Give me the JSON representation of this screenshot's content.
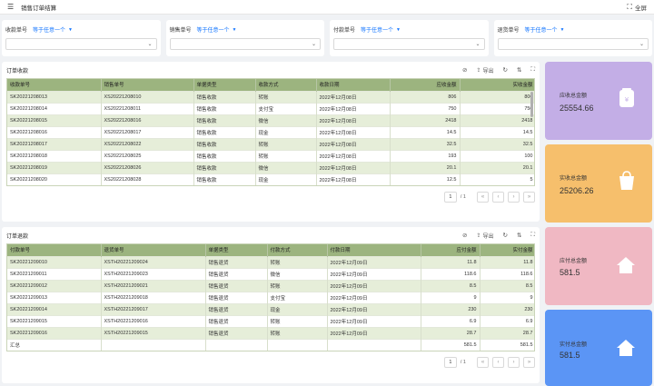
{
  "topbar": {
    "menu_icon": "menu-icon",
    "title": "销售订单结算",
    "fullscreen_label": "全屏"
  },
  "filters": [
    {
      "label": "收款单号",
      "op": "等于任意一个"
    },
    {
      "label": "销售单号",
      "op": "等于任意一个"
    },
    {
      "label": "付款单号",
      "op": "等于任意一个"
    },
    {
      "label": "退货单号",
      "op": "等于任意一个"
    }
  ],
  "receipts": {
    "title": "订单收款",
    "export_label": "导出",
    "columns": [
      "收款单号",
      "销售单号",
      "单据类型",
      "收款方式",
      "收款日期",
      "应收金额",
      "实收金额"
    ],
    "rows": [
      [
        "SK20221208013",
        "XS20221208010",
        "销售收款",
        "转账",
        "2022年12月08日",
        "806",
        "806"
      ],
      [
        "SK20221208014",
        "XS20221208011",
        "销售收款",
        "支付宝",
        "2022年12月08日",
        "750",
        "750"
      ],
      [
        "SK20221208015",
        "XS20221208016",
        "销售收款",
        "微信",
        "2022年12月08日",
        "2418",
        "2418"
      ],
      [
        "SK20221208016",
        "XS20221208017",
        "销售收款",
        "现金",
        "2022年12月08日",
        "14.5",
        "14.5"
      ],
      [
        "SK20221208017",
        "XS20221208022",
        "销售收款",
        "转账",
        "2022年12月08日",
        "32.5",
        "32.5"
      ],
      [
        "SK20221208018",
        "XS20221208025",
        "销售收款",
        "转账",
        "2022年12月08日",
        "193",
        "100"
      ],
      [
        "SK20221208019",
        "XS20221208026",
        "销售收款",
        "微信",
        "2022年12月08日",
        "20.1",
        "20.1"
      ],
      [
        "SK20221208020",
        "XS20221208028",
        "销售收款",
        "现金",
        "2022年12月08日",
        "12.5",
        "5"
      ]
    ],
    "page": "1",
    "of_pages": "/ 1"
  },
  "refunds": {
    "title": "订单退款",
    "export_label": "导出",
    "columns": [
      "付款单号",
      "退货单号",
      "单据类型",
      "付款方式",
      "付款日期",
      "应付金额",
      "实付金额"
    ],
    "rows": [
      [
        "SK20221209010",
        "XSTH20221209024",
        "销售退货",
        "转账",
        "2022年12月09日",
        "11.8",
        "11.8"
      ],
      [
        "SK20221209011",
        "XSTH20221209023",
        "销售退货",
        "微信",
        "2022年12月09日",
        "118.6",
        "118.6"
      ],
      [
        "SK20221209012",
        "XSTH20221209021",
        "销售退货",
        "转账",
        "2022年12月09日",
        "8.5",
        "8.5"
      ],
      [
        "SK20221209013",
        "XSTH20221209018",
        "销售退货",
        "支付宝",
        "2022年12月09日",
        "9",
        "9"
      ],
      [
        "SK20221209014",
        "XSTH20221209017",
        "销售退货",
        "现金",
        "2022年12月09日",
        "230",
        "230"
      ],
      [
        "SK20221209015",
        "XSTH20221209016",
        "销售退货",
        "转账",
        "2022年12月09日",
        "6.9",
        "6.9"
      ],
      [
        "SK20221209016",
        "XSTH20221209015",
        "销售退货",
        "转账",
        "2022年12月09日",
        "28.7",
        "28.7"
      ]
    ],
    "total": {
      "label": "汇总",
      "payable": "581.5",
      "paid": "581.5"
    },
    "page": "1",
    "of_pages": "/ 1"
  },
  "cards": [
    {
      "label": "应收总金额",
      "value": "25554.66",
      "color": "#c3aee6",
      "icon": "yen-bag-icon"
    },
    {
      "label": "实收总金额",
      "value": "25206.26",
      "color": "#f6bf6c",
      "icon": "shopping-bag-icon"
    },
    {
      "label": "应付总金额",
      "value": "581.5",
      "color": "#f0b8c3",
      "icon": "home-icon"
    },
    {
      "label": "实付总金额",
      "value": "581.5",
      "color": "#5b95f5",
      "icon": "home-icon"
    }
  ]
}
